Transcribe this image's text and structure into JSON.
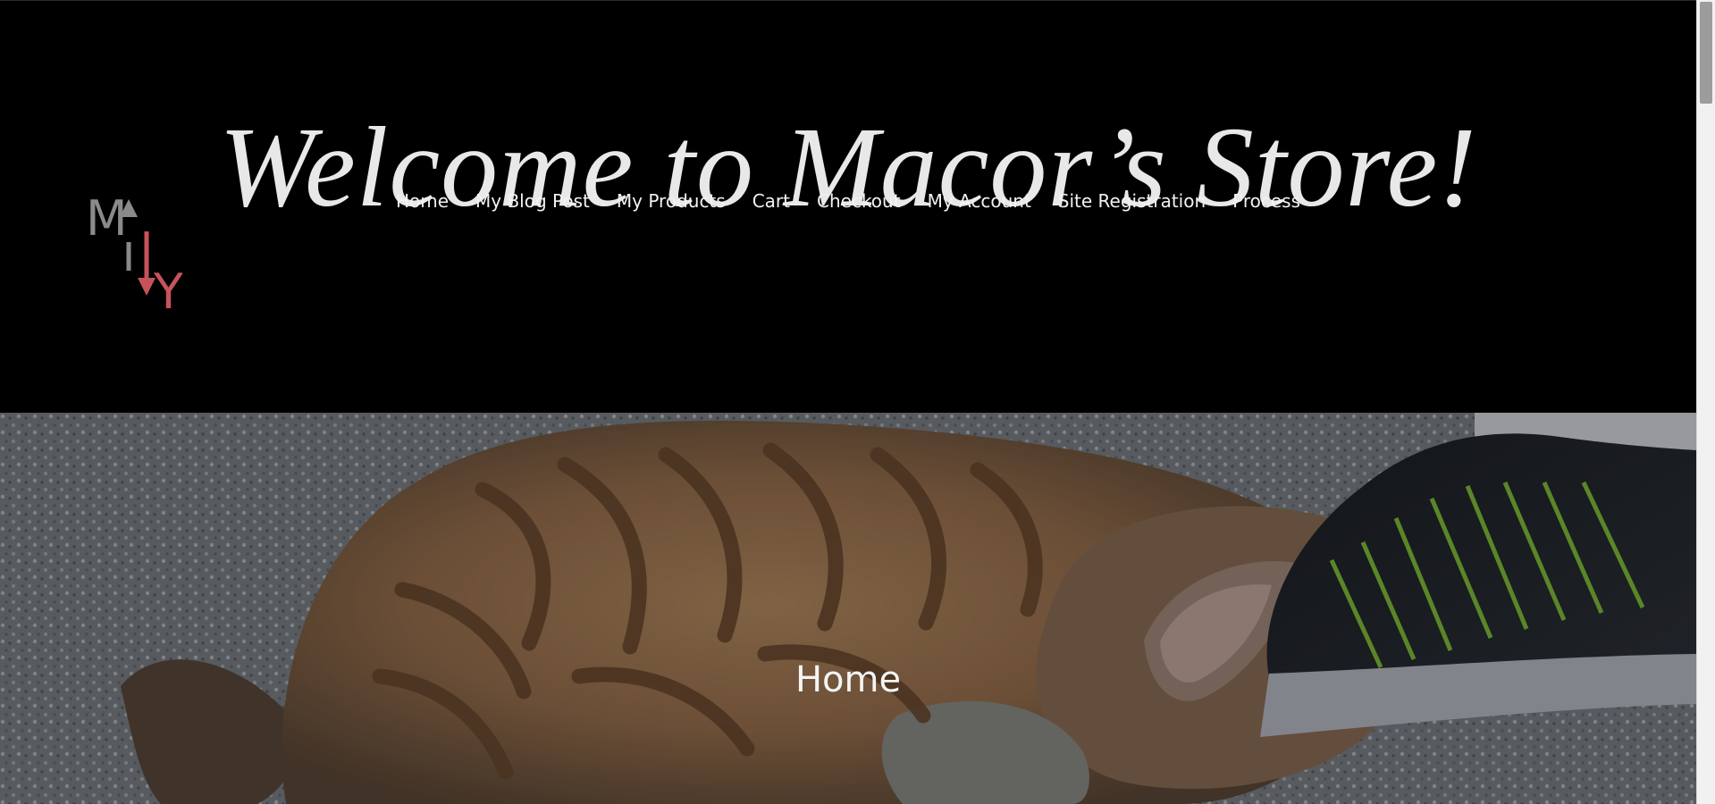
{
  "header": {
    "site_title": "Welcome to Macor’s Store!",
    "logo": {
      "icon": "my-logo-icon",
      "letters": [
        "M",
        "Y"
      ],
      "colors": {
        "gray": "#8a8a8a",
        "red": "#c6535b"
      }
    },
    "nav": [
      {
        "label": "Home"
      },
      {
        "label": "My Blog Post"
      },
      {
        "label": "My Products"
      },
      {
        "label": "Cart"
      },
      {
        "label": "Checkout"
      },
      {
        "label": "My Account"
      },
      {
        "label": "Site Registration"
      },
      {
        "label": "Process"
      }
    ]
  },
  "hero": {
    "title": "Home",
    "image": {
      "icon": "cat-photo-icon"
    }
  },
  "colors": {
    "header_bg": "#000000",
    "title_text": "#e8e8e8",
    "nav_text": "#f2f2f2",
    "hero_text": "#f4f4f4"
  }
}
